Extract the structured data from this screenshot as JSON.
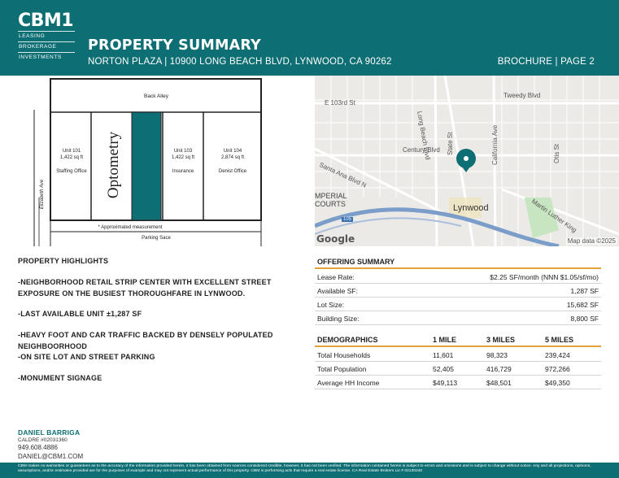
{
  "brand": {
    "name": "CBM1",
    "tagline": [
      "LEASING",
      "BROKERAGE",
      "INVESTMENTS"
    ]
  },
  "header": {
    "title": "PROPERTY SUMMARY",
    "subtitle": "NORTON PLAZA | 10900 LONG BEACH BLVD, LYNWOOD, CA 90262",
    "page_label": "BROCHURE | PAGE 2"
  },
  "site_plan": {
    "back_alley": "Back Alley",
    "street": "Elizabeth Ave",
    "parking": "Parking Sace",
    "note": "* Approximated measurement",
    "tenant_big": "Optometry",
    "units": [
      {
        "name": "Unit 101",
        "size": "1,422 sq ft",
        "tenant": "Staffing Office"
      },
      {
        "name": "Unit 103",
        "size": "1,422 sq ft",
        "tenant": "Insurance"
      },
      {
        "name": "Unit 104",
        "size": "2,874 sq ft",
        "tenant": "Denist Office"
      }
    ]
  },
  "map": {
    "labels": {
      "e103": "E 103rd St",
      "tweedy": "Tweedy Blvd",
      "longbeach": "Long Beach Blvd",
      "century": "Century Blvd",
      "statest": "State St",
      "santaana": "Santa Ana Blvd N",
      "california": "California Ave",
      "otis": "Otis St",
      "imperial1": "MPERIAL",
      "imperial2": "COURTS",
      "mlk": "Martin Luther King",
      "i105": "105"
    },
    "city": "Lynwood",
    "logo": "Google",
    "attribution": "Map data ©2025"
  },
  "highlights": {
    "title": "PROPERTY HIGHLIGHTS",
    "items": [
      "-NEIGHBORHOOD RETAIL STRIP CENTER WITH EXCELLENT STREET EXPOSURE ON THE BUSIEST THOROUGHFARE IN LYNWOOD.",
      "-LAST AVAILABLE UNIT ±1,287 SF",
      "-HEAVY FOOT AND CAR TRAFFIC BACKED BY DENSELY POPULATED NEIGHBOORHOOD",
      "-ON SITE LOT AND STREET PARKING",
      "-MONUMENT SIGNAGE"
    ]
  },
  "offering": {
    "title": "OFFERING SUMMARY",
    "rows": [
      {
        "label": "Lease Rate:",
        "value": "$2.25 SF/month (NNN $1.05/sf/mo)"
      },
      {
        "label": "Available SF:",
        "value": "1,287 SF"
      },
      {
        "label": "Lot Size:",
        "value": "15,682 SF"
      },
      {
        "label": "Building Size:",
        "value": "8,800 SF"
      }
    ]
  },
  "demographics": {
    "title": "DEMOGRAPHICS",
    "columns": [
      "1 MILE",
      "3 MILES",
      "5 MILES"
    ],
    "rows": [
      {
        "label": "Total Households",
        "values": [
          "11,601",
          "98,323",
          "239,424"
        ]
      },
      {
        "label": "Total Population",
        "values": [
          "52,405",
          "416,729",
          "972,266"
        ]
      },
      {
        "label": "Average HH Income",
        "values": [
          "$49,113",
          "$48,501",
          "$49,350"
        ]
      }
    ]
  },
  "contact": {
    "name": "DANIEL BARRIGA",
    "license": "CALDRE #02031360",
    "phone": "949.608.4886",
    "email": "DANIEL@CBM1.COM"
  },
  "footer": {
    "disclaimer": "CBM makes no warranties or guarantees as to the accuracy of the information provided herein, it has been obtained from sources considered credible, however, it has not been verified. The information contained herein is subject to errors and omissions and is subject to change without notice. Any and all projections, opinions, assumptions, and/or estimates provided are for the purposes of example and may not represent actual performance of this property. CBM is performing acts that require a real estate license. CA Real Estate Brokers Lic # 02130240"
  },
  "colors": {
    "brand_teal": "#0d6e74",
    "accent_orange": "#e0a33a"
  }
}
